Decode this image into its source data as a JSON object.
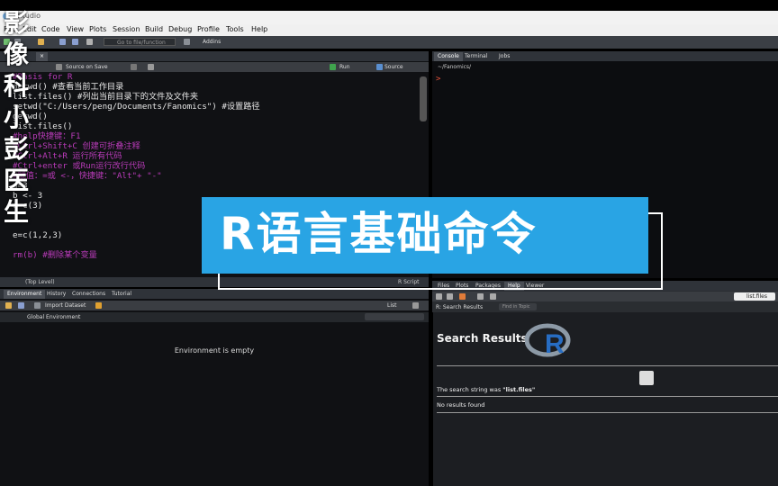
{
  "window": {
    "title": "RStudio"
  },
  "menu": [
    "File",
    "Edit",
    "Code",
    "View",
    "Plots",
    "Session",
    "Build",
    "Debug",
    "Profile",
    "Tools",
    "Help"
  ],
  "toolbar": {
    "goto_placeholder": "Go to file/function",
    "addins": "Addins"
  },
  "editor": {
    "source_on_save": "Source on Save",
    "run": "Run",
    "source": "Source",
    "status_left": "(Top Level)",
    "status_right": "R Script",
    "lines": [
      {
        "t": "#Basis for R",
        "c": "cmt"
      },
      {
        "t": "getwd() #查看当前工作目录",
        "c": "fn"
      },
      {
        "t": "list.files() #列出当前目录下的文件及文件夹",
        "c": "fn"
      },
      {
        "t": "setwd(\"C:/Users/peng/Documents/Fanomics\") #设置路径",
        "c": "fn"
      },
      {
        "t": "getwd()",
        "c": "fn"
      },
      {
        "t": "list.files()",
        "c": "fn"
      },
      {
        "t": "#help快捷键：F1",
        "c": "cmt"
      },
      {
        "t": "#Ctrl+Shift+C 创建可折叠注释",
        "c": "cmt"
      },
      {
        "t": "#Ctrl+Alt+R 运行所有代码",
        "c": "cmt"
      },
      {
        "t": "#Ctrl+enter 或Run运行改行代码",
        "c": "cmt"
      },
      {
        "t": "#赋值：=或 <-，快捷键：\"Alt\"+ \"-\"",
        "c": "cmt"
      },
      {
        "t": "a=3",
        "c": "fn"
      },
      {
        "t": "b <- 3",
        "c": "fn"
      },
      {
        "t": "d=c(3)",
        "c": "fn"
      },
      {
        "t": "",
        "c": "fn"
      },
      {
        "t": "",
        "c": "fn"
      },
      {
        "t": "e=c(1,2,3)",
        "c": "fn"
      },
      {
        "t": "",
        "c": "fn"
      },
      {
        "t": "rm(b) #删除某个变量",
        "c": "cmt"
      }
    ]
  },
  "env_pane": {
    "tabs": [
      "Environment",
      "History",
      "Connections",
      "Tutorial"
    ],
    "import_dataset": "Import Dataset",
    "list_label": "List",
    "scope": "Global Environment",
    "empty_msg": "Environment is empty"
  },
  "console": {
    "tabs": [
      "Console",
      "Terminal",
      "Jobs"
    ],
    "path": "~/Fanomics/",
    "prompt": ">"
  },
  "help_pane": {
    "tabs": [
      "Files",
      "Plots",
      "Packages",
      "Help",
      "Viewer"
    ],
    "search_value": "list.files",
    "topic_label": "R: Search Results",
    "find_placeholder": "Find in Topic",
    "heading": "Search Results",
    "search_string_prefix": "The search string was ",
    "search_string": "\"list.files\"",
    "no_results": "No results found"
  },
  "overlay": {
    "side_title": [
      "影",
      "像",
      "科",
      "小",
      "彭",
      "医",
      "生"
    ],
    "banner_text": "R语言基础命令"
  },
  "colors": {
    "banner": "#29a4e4",
    "comment": "#b93bb9",
    "string": "#8be28b",
    "prompt": "#e9523a"
  }
}
